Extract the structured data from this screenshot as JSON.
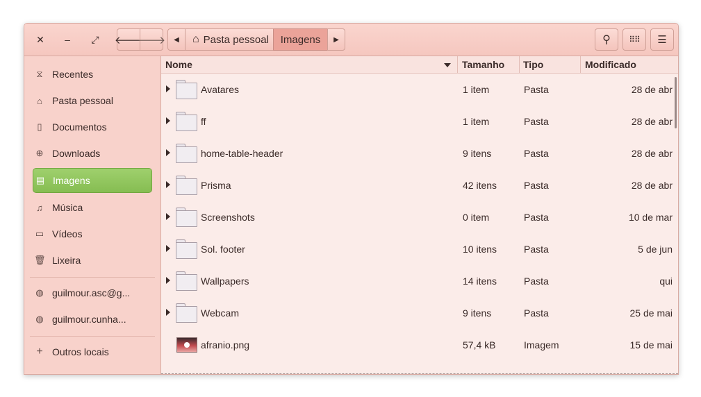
{
  "window": {
    "controls": {
      "close": "✕",
      "minimize": "–",
      "maximize": "⤢"
    }
  },
  "toolbar": {
    "back_icon": "arrow-left-icon",
    "forward_icon": "arrow-right-icon",
    "breadcrumb": [
      {
        "label": "Pasta pessoal",
        "icon": "home-icon"
      },
      {
        "label": "Imagens"
      }
    ],
    "search_icon": "search-icon",
    "view_icon": "grid-view-icon",
    "menu_icon": "hamburger-menu-icon"
  },
  "sidebar": {
    "items": [
      {
        "label": "Recentes",
        "icon": "⧖"
      },
      {
        "label": "Pasta pessoal",
        "icon": "⌂"
      },
      {
        "label": "Documentos",
        "icon": "▯"
      },
      {
        "label": "Downloads",
        "icon": "⊕"
      },
      {
        "label": "Imagens",
        "icon": "▤"
      },
      {
        "label": "Música",
        "icon": "♫"
      },
      {
        "label": "Vídeos",
        "icon": "▭"
      },
      {
        "label": "Lixeira",
        "icon": "🗑"
      }
    ],
    "network": [
      {
        "label": "guilmour.asc@g...",
        "icon": "◍"
      },
      {
        "label": "guilmour.cunha...",
        "icon": "◍"
      }
    ],
    "other": {
      "label": "Outros locais",
      "icon": "+"
    }
  },
  "columns": {
    "name": "Nome",
    "size": "Tamanho",
    "type": "Tipo",
    "modified": "Modificado"
  },
  "files": [
    {
      "name": "Avatares",
      "size": "1 item",
      "type": "Pasta",
      "modified": "28 de abr",
      "kind": "folder"
    },
    {
      "name": "ff",
      "size": "1 item",
      "type": "Pasta",
      "modified": "28 de abr",
      "kind": "folder"
    },
    {
      "name": "home-table-header",
      "size": "9 itens",
      "type": "Pasta",
      "modified": "28 de abr",
      "kind": "folder"
    },
    {
      "name": "Prisma",
      "size": "42 itens",
      "type": "Pasta",
      "modified": "28 de abr",
      "kind": "folder"
    },
    {
      "name": "Screenshots",
      "size": "0 item",
      "type": "Pasta",
      "modified": "10 de mar",
      "kind": "folder"
    },
    {
      "name": "Sol. footer",
      "size": "10 itens",
      "type": "Pasta",
      "modified": "5 de jun",
      "kind": "folder"
    },
    {
      "name": "Wallpapers",
      "size": "14 itens",
      "type": "Pasta",
      "modified": "qui",
      "kind": "folder"
    },
    {
      "name": "Webcam",
      "size": "9 itens",
      "type": "Pasta",
      "modified": "25 de mai",
      "kind": "folder"
    },
    {
      "name": "afranio.png",
      "size": "57,4 kB",
      "type": "Imagem",
      "modified": "15 de mai",
      "kind": "image"
    }
  ]
}
